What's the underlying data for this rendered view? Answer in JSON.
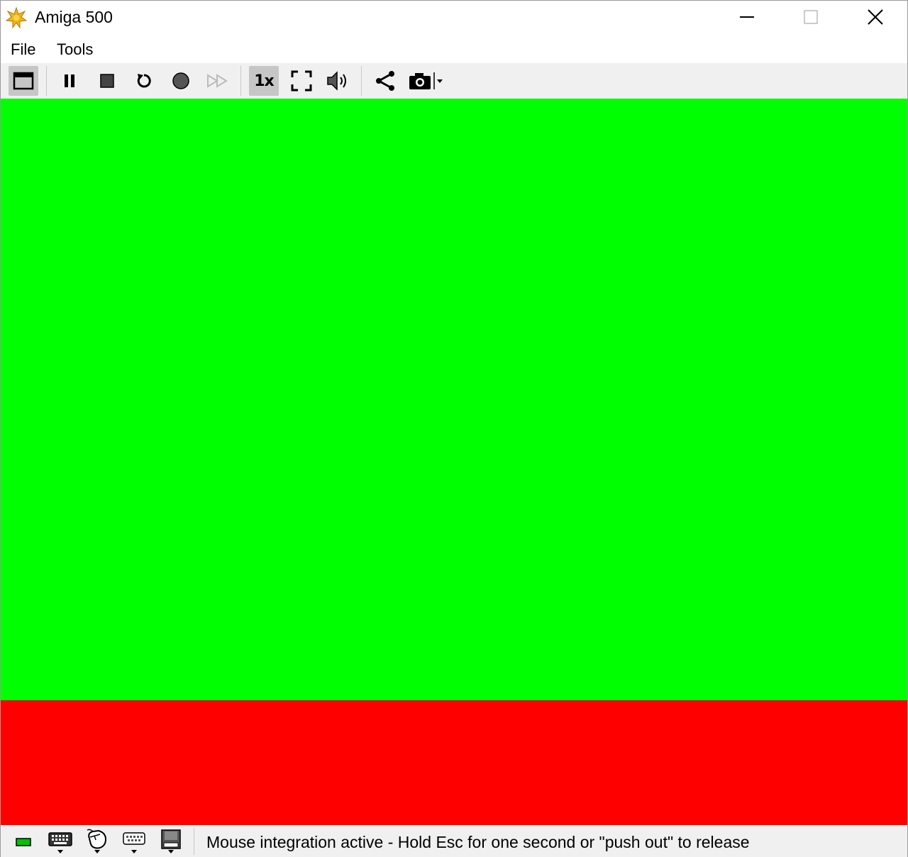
{
  "window": {
    "title": "Amiga 500",
    "app_icon": "amiga-star-icon",
    "controls": {
      "minimize": "minimize-icon",
      "maximize": "maximize-icon",
      "close": "close-icon"
    }
  },
  "menu": {
    "items": [
      {
        "label": "File"
      },
      {
        "label": "Tools"
      }
    ]
  },
  "toolbar": {
    "items": [
      {
        "icon": "window-mode-icon",
        "active": true
      },
      {
        "icon": "pause-icon"
      },
      {
        "icon": "stop-icon"
      },
      {
        "icon": "reset-icon"
      },
      {
        "icon": "record-icon"
      },
      {
        "icon": "fast-forward-icon",
        "disabled": true
      },
      {
        "icon": "speed-1x-icon",
        "label": "1x",
        "active": true
      },
      {
        "icon": "fullscreen-icon"
      },
      {
        "icon": "volume-icon"
      },
      {
        "icon": "share-icon"
      },
      {
        "icon": "screenshot-icon"
      }
    ]
  },
  "display": {
    "top_color": "#00ff00",
    "bottom_color": "#ff0000"
  },
  "statusbar": {
    "icons": [
      "power-led-icon",
      "keyboard-icon",
      "mouse-icon",
      "gamepad-icon",
      "floppy-drive-icon"
    ],
    "power_led_color": "#00c000",
    "message": "Mouse integration active - Hold Esc for one second or \"push out\" to release"
  }
}
